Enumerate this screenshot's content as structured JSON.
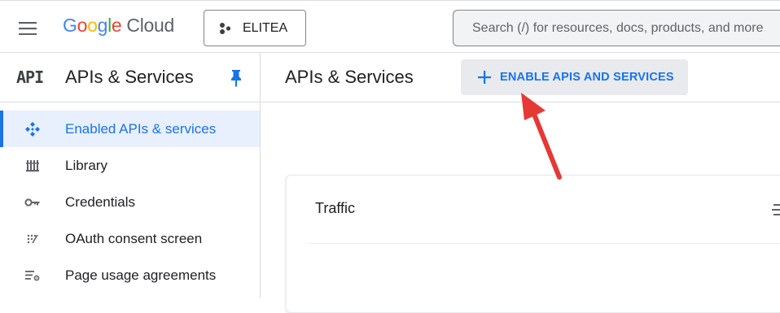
{
  "topbar": {
    "logo_letters": [
      "G",
      "o",
      "o",
      "g",
      "l",
      "e"
    ],
    "logo_suffix": "Cloud",
    "project_name": "ELITEA",
    "search_placeholder": "Search (/) for resources, docs, products, and more"
  },
  "sidebar": {
    "badge": "API",
    "title": "APIs & Services",
    "items": [
      {
        "label": "Enabled APIs & services",
        "icon": "enabled-apis-icon",
        "active": true
      },
      {
        "label": "Library",
        "icon": "library-icon",
        "active": false
      },
      {
        "label": "Credentials",
        "icon": "key-icon",
        "active": false
      },
      {
        "label": "OAuth consent screen",
        "icon": "oauth-consent-icon",
        "active": false
      },
      {
        "label": "Page usage agreements",
        "icon": "page-usage-settings-icon",
        "active": false
      }
    ]
  },
  "main": {
    "title": "APIs & Services",
    "enable_button_label": "ENABLE APIS AND SERVICES",
    "traffic_card": {
      "title": "Traffic"
    }
  },
  "colors": {
    "accent": "#1a73e8",
    "active_bg": "#e8f0fe",
    "annotation_arrow": "#e53935"
  }
}
